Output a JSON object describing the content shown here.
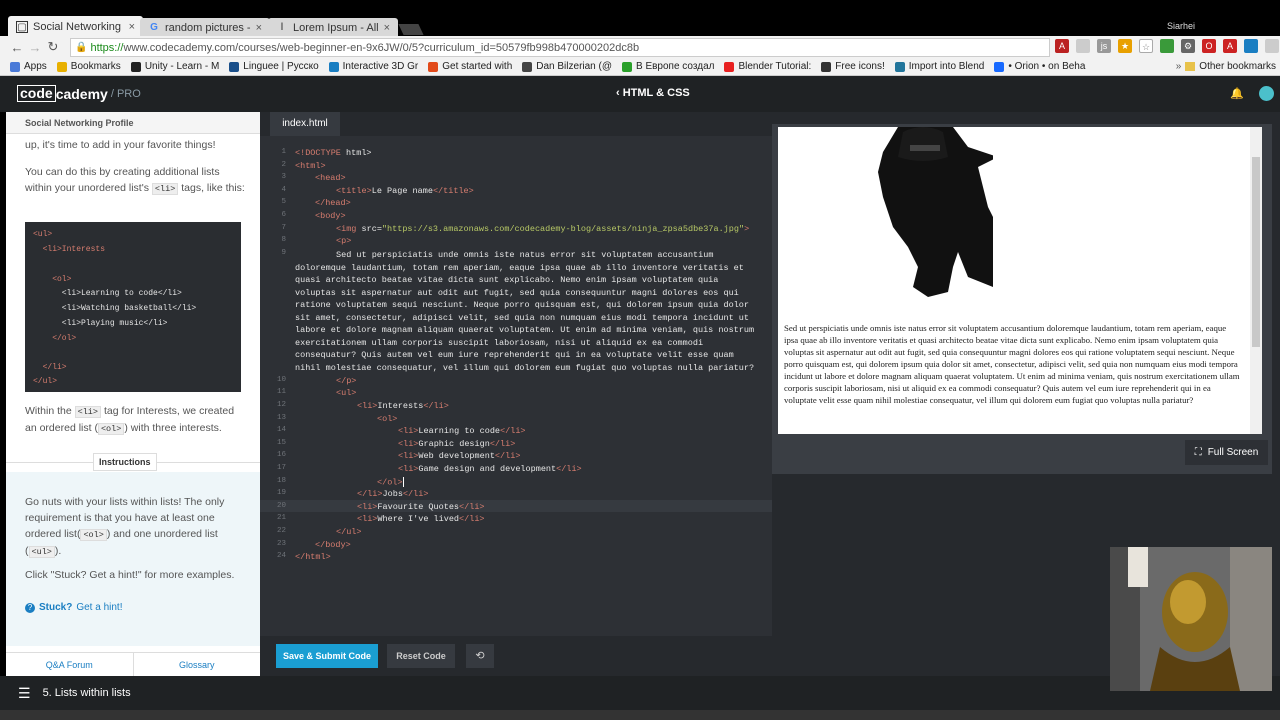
{
  "browser": {
    "tabs": [
      {
        "title": "Social Networking Pr",
        "icon": "codecademy-icon",
        "active": true
      },
      {
        "title": "random pictures - G",
        "icon": "google-icon",
        "active": false
      },
      {
        "title": "Lorem Ipsum - All th",
        "icon": "lorem-icon",
        "active": false
      }
    ],
    "close_glyph": "×",
    "user": "Siarhei",
    "url_scheme": "https://",
    "url_rest": "www.codecademy.com/courses/web-beginner-en-9x6JW/0/5?curriculum_id=50579fb998b470000202dc8b",
    "bookmarks": [
      {
        "label": "Apps",
        "color": "#4a7ad8"
      },
      {
        "label": "Bookmarks",
        "color": "#e8b000"
      },
      {
        "label": "Unity - Learn - M",
        "color": "#222"
      },
      {
        "label": "Linguee | Русско",
        "color": "#1a4f8a"
      },
      {
        "label": "Interactive 3D Gr",
        "color": "#1a7ec2"
      },
      {
        "label": "Get started with",
        "color": "#e24a1a"
      },
      {
        "label": "Dan Bilzerian (@",
        "color": "#444"
      },
      {
        "label": "В Европе создал",
        "color": "#2aa02a"
      },
      {
        "label": "Blender Tutorial:",
        "color": "#e82020"
      },
      {
        "label": "Free icons!",
        "color": "#333"
      },
      {
        "label": "Import into Blend",
        "color": "#21759b"
      },
      {
        "label": "• Orion • on Beha",
        "color": "#1769ff"
      }
    ],
    "other_bookmarks": "Other bookmarks"
  },
  "header": {
    "logo_box": "code",
    "logo_rest": "cademy",
    "logo_pro": "/ PRO",
    "course": "‹ HTML & CSS"
  },
  "lesson": {
    "title": "Social Networking Profile",
    "intro": "up, it's time to add in your favorite things!",
    "p1_a": "You can do this by creating additional lists within your unordered list's",
    "p1_code": "<li>",
    "p1_b": "tags, like this:",
    "example": [
      "<ul>",
      "  <li>Interests",
      "",
      "    <ol>",
      "      <li>Learning to code</li>",
      "      <li>Watching basketball</li>",
      "      <li>Playing music</li>",
      "    </ol>",
      "",
      "  </li>",
      "</ul>"
    ],
    "p2_a": "Within the",
    "p2_code1": "<li>",
    "p2_b": "tag for Interests, we created an ordered list (",
    "p2_code2": "<ol>",
    "p2_c": ") with three interests.",
    "instructions_title": "Instructions",
    "i1_a": "Go nuts with your lists within lists! The only requirement is that you have at least one ordered list(",
    "i1_code1": "<ol>",
    "i1_b": ") and one unordered list (",
    "i1_code2": "<ul>",
    "i1_c": ").",
    "i2": "Click \"Stuck? Get a hint!\" for more examples.",
    "stuck": "Stuck?",
    "hint": "Get a hint!",
    "qa": "Q&A Forum",
    "glossary": "Glossary"
  },
  "editor": {
    "file_tab": "index.html",
    "line_numbers": [
      "1",
      "2",
      "3",
      "4",
      "5",
      "6",
      "7",
      "8",
      "9",
      "10",
      "11",
      "12",
      "13",
      "14",
      "15",
      "16",
      "17",
      "18",
      "19",
      "20",
      "21",
      "22",
      "23",
      "24"
    ],
    "current_line": 18,
    "code": {
      "l1_open": "<!",
      "l1_kw": "DOCTYPE",
      "l1_rest": " html>",
      "l2": "<html>",
      "l3": "<head>",
      "l4_open": "<title>",
      "l4_text": "Le Page name",
      "l4_close": "</title>",
      "l5": "</head>",
      "l6": "<body>",
      "l7_open": "<img ",
      "l7_attr": "src=",
      "l7_val": "\"https://s3.amazonaws.com/codecademy-blog/assets/ninja_zpsa5dbe37a.jpg\"",
      "l7_close": ">",
      "l8": "<p>",
      "l9": "Sed ut perspiciatis unde omnis iste natus error sit voluptatem accusantium doloremque laudantium, totam rem aperiam, eaque ipsa quae ab illo inventore veritatis et quasi architecto beatae vitae dicta sunt explicabo. Nemo enim ipsam voluptatem quia voluptas sit aspernatur aut odit aut fugit, sed quia consequuntur magni dolores eos qui ratione voluptatem sequi nesciunt. Neque porro quisquam est, qui dolorem ipsum quia dolor sit amet, consectetur, adipisci velit, sed quia non numquam eius modi tempora incidunt ut labore et dolore magnam aliquam quaerat voluptatem. Ut enim ad minima veniam, quis nostrum exercitationem ullam corporis suscipit laboriosam, nisi ut aliquid ex ea commodi consequatur? Quis autem vel eum iure reprehenderit qui in ea voluptate velit esse quam nihil molestiae consequatur, vel illum qui dolorem eum fugiat quo voluptas nulla pariatur?",
      "l10": "</p>",
      "l11": "<ul>",
      "l12_open": "<li>",
      "l12_text": "Interests",
      "l12_close": "</li>",
      "l13": "<ol>",
      "l14_open": "<li>",
      "l14_text": "Learning to code",
      "l14_close": "</li>",
      "l15_open": "<li>",
      "l15_text": "Graphic design",
      "l15_close": "</li>",
      "l16_open": "<li>",
      "l16_text": "Web development",
      "l16_close": "</li>",
      "l17_open": "<li>",
      "l17_text": "Game design and development",
      "l17_close": "</li>",
      "l18": "</ol>",
      "l19_open": "</li>",
      "l19_text": "Jobs",
      "l19_close": "</li>",
      "l20_open": "<li>",
      "l20_text": "Favourite Quotes",
      "l20_close": "</li>",
      "l21_open": "<li>",
      "l21_text": "Where I've lived",
      "l21_close": "</li>",
      "l22": "</ul>",
      "l23": "</body>",
      "l24": "</html>"
    }
  },
  "preview": {
    "text": "Sed ut perspiciatis unde omnis iste natus error sit voluptatem accusantium doloremque laudantium, totam rem aperiam, eaque ipsa quae ab illo inventore veritatis et quasi architecto beatae vitae dicta sunt explicabo. Nemo enim ipsam voluptatem quia voluptas sit aspernatur aut odit aut fugit, sed quia consequuntur magni dolores eos qui ratione voluptatem sequi nesciunt. Neque porro quisquam est, qui dolorem ipsum quia dolor sit amet, consectetur, adipisci velit, sed quia non numquam eius modi tempora incidunt ut labore et dolore magnam aliquam quaerat voluptatem. Ut enim ad minima veniam, quis nostrum exercitationem ullam corporis suscipit laboriosam, nisi ut aliquid ex ea commodi consequatur? Quis autem vel eum iure reprehenderit qui in ea voluptate velit esse quam nihil molestiae consequatur, vel illum qui dolorem eum fugiat quo voluptas nulla pariatur?",
    "fullscreen": "Full Screen"
  },
  "buttons": {
    "submit": "Save & Submit Code",
    "reset": "Reset Code"
  },
  "footer": {
    "lesson_label": "5. Lists within lists"
  }
}
